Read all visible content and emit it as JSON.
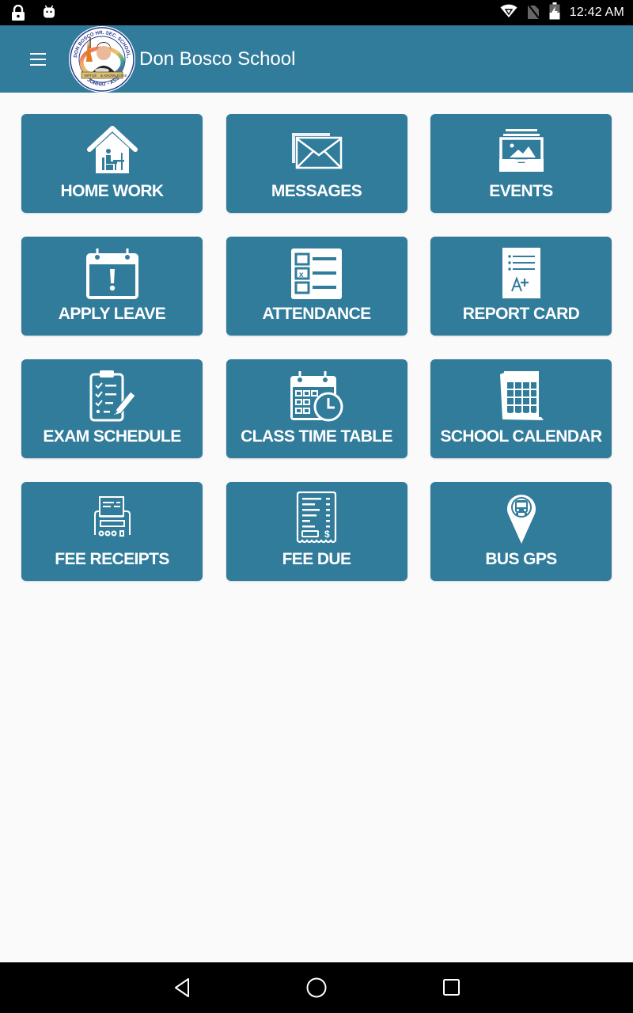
{
  "status_bar": {
    "time": "12:42 AM",
    "left_icons": [
      "lock-icon",
      "android-icon"
    ],
    "right_icons": [
      "wifi-icon",
      "no-sim-icon",
      "battery-charging-icon"
    ]
  },
  "app_bar": {
    "title": "Don Bosco School",
    "menu_icon": "hamburger-menu-icon",
    "logo": {
      "top_text": "DON BOSCO HR. SEC. SCHOOL, BAGHCHUNG",
      "banner_left": "VIRTUE",
      "banner_right": "& KNOWLEDGE",
      "bottom_text": "JORHAT - ASSAM"
    }
  },
  "colors": {
    "primary": "#317c9b",
    "background": "#fafafa",
    "tile_text": "#ffffff"
  },
  "tiles": [
    {
      "label": "HOME WORK",
      "icon": "house-study-icon"
    },
    {
      "label": "MESSAGES",
      "icon": "envelope-icon"
    },
    {
      "label": "EVENTS",
      "icon": "photo-album-icon"
    },
    {
      "label": "APPLY LEAVE",
      "icon": "calendar-alert-icon"
    },
    {
      "label": "ATTENDANCE",
      "icon": "checklist-icon"
    },
    {
      "label": "REPORT CARD",
      "icon": "report-card-icon"
    },
    {
      "label": "EXAM SCHEDULE",
      "icon": "clipboard-check-icon"
    },
    {
      "label": "CLASS TIME TABLE",
      "icon": "calendar-clock-icon"
    },
    {
      "label": "SCHOOL CALENDAR",
      "icon": "wall-calendar-icon"
    },
    {
      "label": "FEE RECEIPTS",
      "icon": "receipt-printer-icon"
    },
    {
      "label": "FEE DUE",
      "icon": "bill-icon"
    },
    {
      "label": "BUS GPS",
      "icon": "bus-location-pin-icon"
    }
  ],
  "nav_bar": {
    "buttons": [
      "back-icon",
      "home-icon",
      "recents-icon"
    ]
  }
}
